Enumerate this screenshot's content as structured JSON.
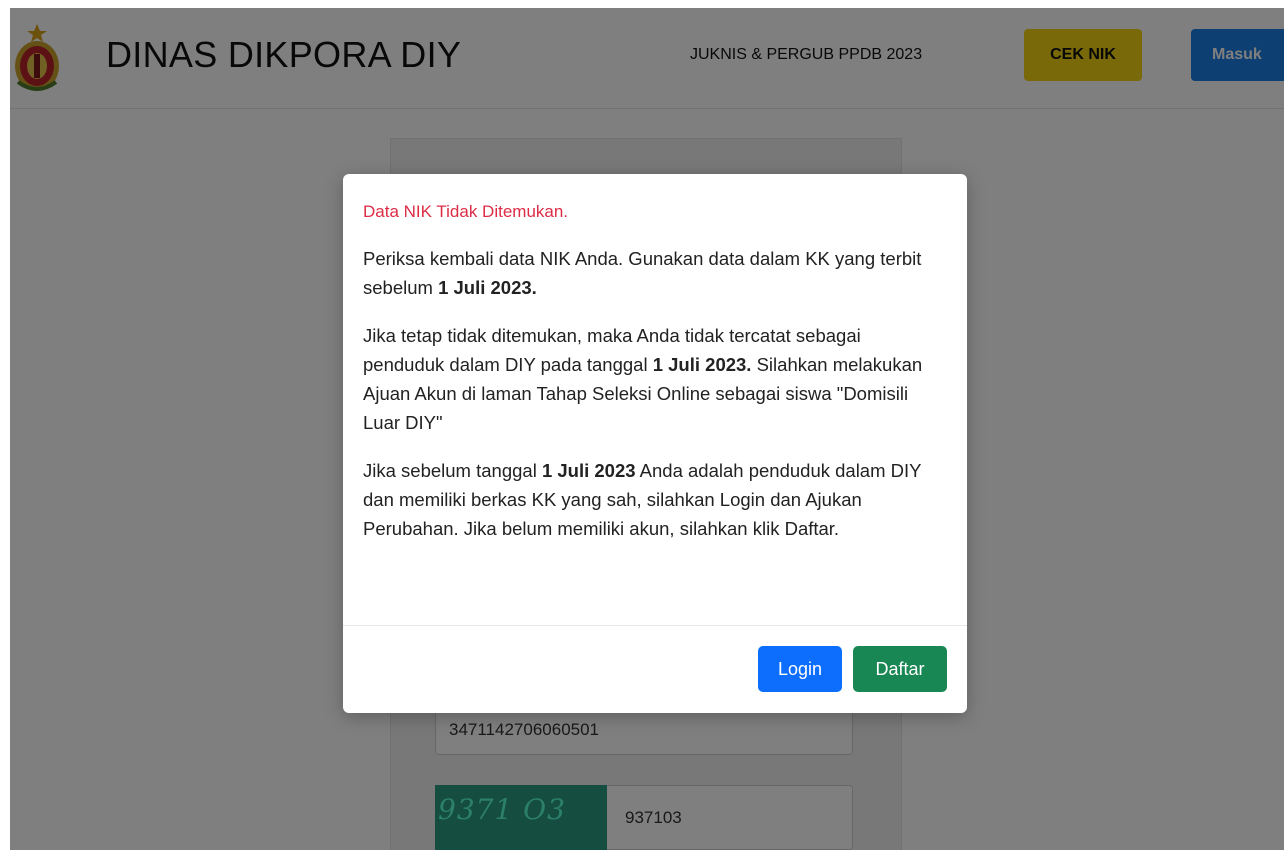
{
  "navbar": {
    "brand": "DINAS DIKPORA DIY",
    "link_juknis": "JUKNIS & PERGUB PPDB 2023",
    "button_ceknik": "CEK NIK",
    "button_masuk": "Masuk"
  },
  "form": {
    "nik_value": "3471142706060501",
    "captcha_image_text": "9371 O3",
    "captcha_value": "937103"
  },
  "modal": {
    "title": "Data NIK Tidak Ditemukan.",
    "p1_a": "Periksa kembali data NIK Anda. Gunakan data dalam KK yang terbit sebelum ",
    "p1_b": "1 Juli 2023.",
    "p2_a": "Jika tetap tidak ditemukan, maka Anda tidak tercatat sebagai penduduk dalam DIY pada tanggal ",
    "p2_b": "1 Juli 2023.",
    "p2_c": " Silahkan melakukan Ajuan Akun di laman Tahap Seleksi Online sebagai siswa \"Domisili Luar DIY\"",
    "p3_a": "Jika sebelum tanggal ",
    "p3_b": "1 Juli 2023",
    "p3_c": " Anda adalah penduduk dalam DIY dan memiliki berkas KK yang sah, silahkan Login dan Ajukan Perubahan. Jika belum memiliki akun, silahkan klik Daftar.",
    "button_login": "Login",
    "button_daftar": "Daftar"
  },
  "colors": {
    "title_red": "#dc2d45",
    "login_blue": "#0d6efd",
    "daftar_green": "#198754",
    "ceknik_yellow": "#f2d313",
    "masuk_blue": "#1a7ee5"
  }
}
